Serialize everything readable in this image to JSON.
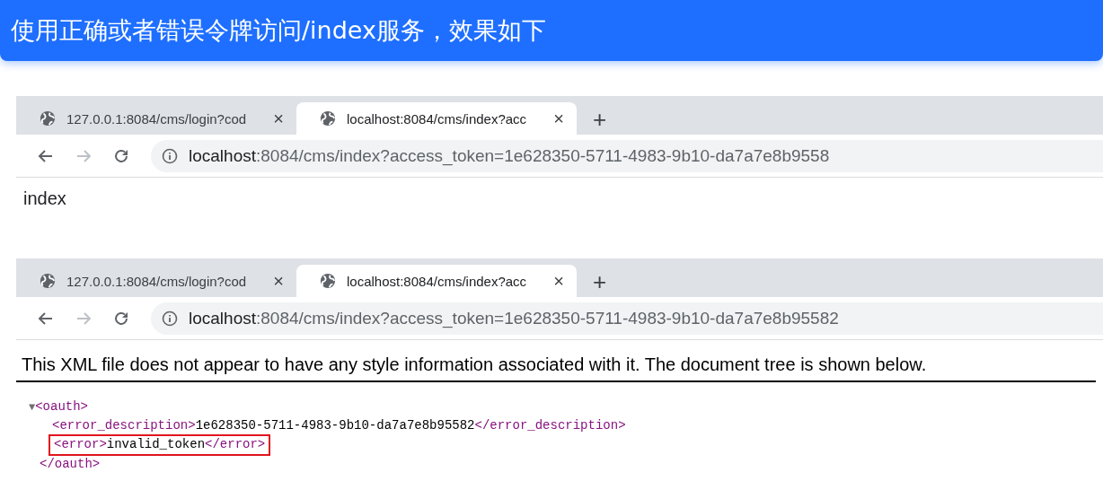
{
  "header": {
    "title": "使用正确或者错误令牌访问/index服务，效果如下"
  },
  "browsers": [
    {
      "tabs": [
        {
          "title": "127.0.0.1:8084/cms/login?cod",
          "close": "×",
          "selected": false
        },
        {
          "title": "localhost:8084/cms/index?acc",
          "close": "×",
          "selected": true
        }
      ],
      "new_tab": "+",
      "address": {
        "host": "localhost",
        "rest": ":8084/cms/index?access_token=1e628350-5711-4983-9b10-da7a7e8b9558"
      },
      "content": {
        "kind": "text",
        "text": "index"
      }
    },
    {
      "tabs": [
        {
          "title": "127.0.0.1:8084/cms/login?cod",
          "close": "×",
          "selected": false
        },
        {
          "title": "localhost:8084/cms/index?acc",
          "close": "×",
          "selected": true
        }
      ],
      "new_tab": "+",
      "address": {
        "host": "localhost",
        "rest": ":8084/cms/index?access_token=1e628350-5711-4983-9b10-da7a7e8b95582"
      },
      "content": {
        "kind": "xml",
        "notice": "This XML file does not appear to have any style information associated with it. The document tree is shown below.",
        "tree": {
          "toggle": "▼",
          "open": "<oauth>",
          "close": "</oauth>",
          "children": [
            {
              "open": "<error_description>",
              "text": "1e628350-5711-4983-9b10-da7a7e8b95582",
              "close": "</error_description>",
              "highlighted": false
            },
            {
              "open": "<error>",
              "text": "invalid_token",
              "close": "</error>",
              "highlighted": true
            }
          ]
        }
      }
    }
  ]
}
